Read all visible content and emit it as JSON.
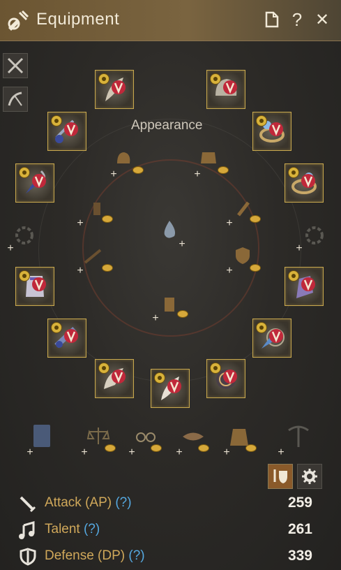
{
  "window": {
    "title": "Equipment",
    "accent": "#c9a94e"
  },
  "titlebar": {
    "icons": [
      "equipment-title-icon",
      "page-icon",
      "help-icon",
      "close-icon"
    ],
    "help_glyph": "?",
    "close_glyph": "✕"
  },
  "appearance": {
    "label": "Appearance"
  },
  "slots": {
    "left": [
      "main-weapon",
      "necklace",
      "earring-left",
      "ring-left",
      "belt-left",
      "sub-weapon"
    ],
    "right": [
      "helmet",
      "ring-right",
      "earring-right",
      "gloves",
      "ring-far-right",
      "shoes-center"
    ],
    "badge": "V"
  },
  "stats": [
    {
      "label": "Attack (AP)",
      "help": "(?)",
      "value": "259",
      "icon": "sword-icon"
    },
    {
      "label": "Talent",
      "help": "(?)",
      "value": "261",
      "icon": "music-note-icon"
    },
    {
      "label": "Defense (DP)",
      "help": "(?)",
      "value": "339",
      "icon": "shield-icon"
    }
  ]
}
